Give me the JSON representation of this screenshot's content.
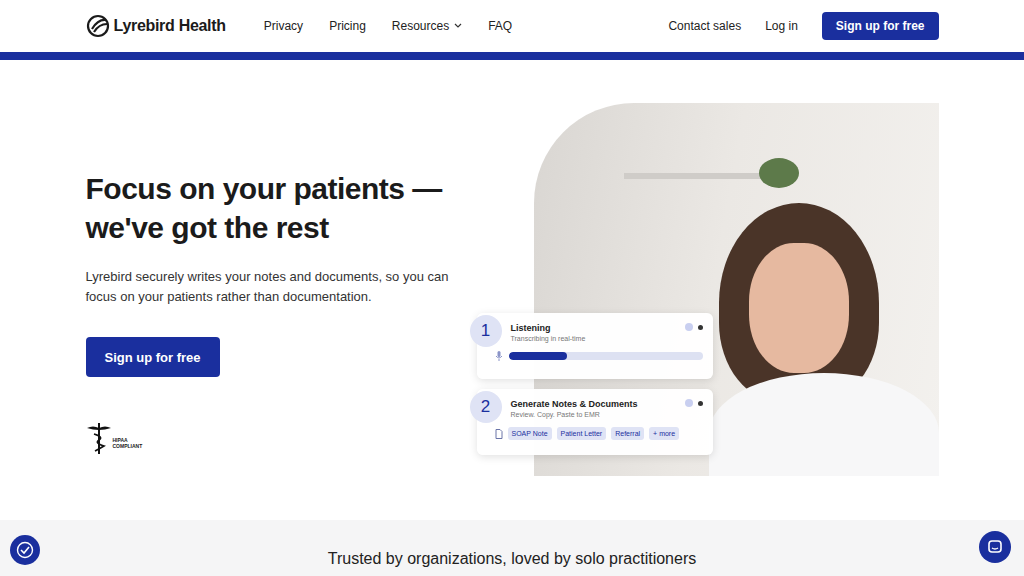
{
  "header": {
    "logo": "Lyrebird Health",
    "nav": [
      {
        "label": "Privacy",
        "dropdown": false
      },
      {
        "label": "Pricing",
        "dropdown": false
      },
      {
        "label": "Resources",
        "dropdown": true
      },
      {
        "label": "FAQ",
        "dropdown": false
      }
    ],
    "contact": "Contact sales",
    "login": "Log in",
    "signup": "Sign up for free"
  },
  "hero": {
    "title_line1": "Focus on your patients —",
    "title_line2": "we've got the rest",
    "text": "Lyrebird securely writes your notes and documents, so you can focus on your patients rather than documentation.",
    "cta": "Sign up for free",
    "badge_line1": "HIPAA",
    "badge_line2": "COMPLIANT"
  },
  "steps": [
    {
      "number": "1",
      "title": "Listening",
      "subtitle": "Transcribing in real-time",
      "kind": "progress",
      "level": 0.3,
      "tags": []
    },
    {
      "number": "2",
      "title": "Generate Notes & Documents",
      "subtitle": "Review. Copy. Paste to EMR",
      "kind": "tags",
      "level": 0,
      "tags": [
        "SOAP Note",
        "Patient Letter",
        "Referral",
        "+ more"
      ]
    }
  ],
  "trusted": "Trusted by organizations, loved by solo practitioners"
}
